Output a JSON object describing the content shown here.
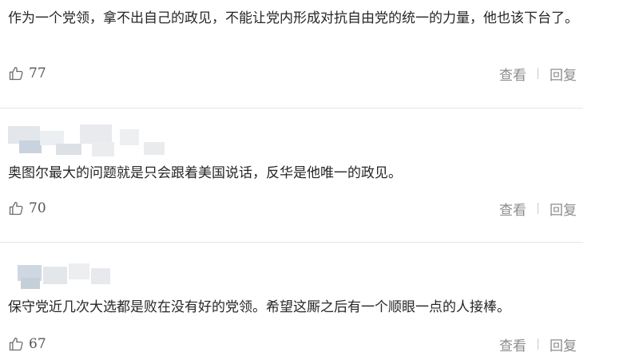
{
  "comments": [
    {
      "text": "作为一个党领，拿不出自己的政见，不能让党内形成对抗自由党的统一的力量，他也该下台了。",
      "likes": "77",
      "view_label": "查看",
      "reply_label": "回复"
    },
    {
      "text": "奥图尔最大的问题就是只会跟着美国说话，反华是他唯一的政见。",
      "likes": "70",
      "view_label": "查看",
      "reply_label": "回复"
    },
    {
      "text": "保守党近几次大选都是败在没有好的党领。希望这厮之后有一个顺眼一点的人接棒。",
      "likes": "67",
      "view_label": "查看",
      "reply_label": "回复"
    }
  ],
  "icons": {
    "like": "thumbs-up-icon"
  },
  "colors": {
    "text": "#262626",
    "muted": "#8c8c8c",
    "divider": "#e6e6e6"
  }
}
